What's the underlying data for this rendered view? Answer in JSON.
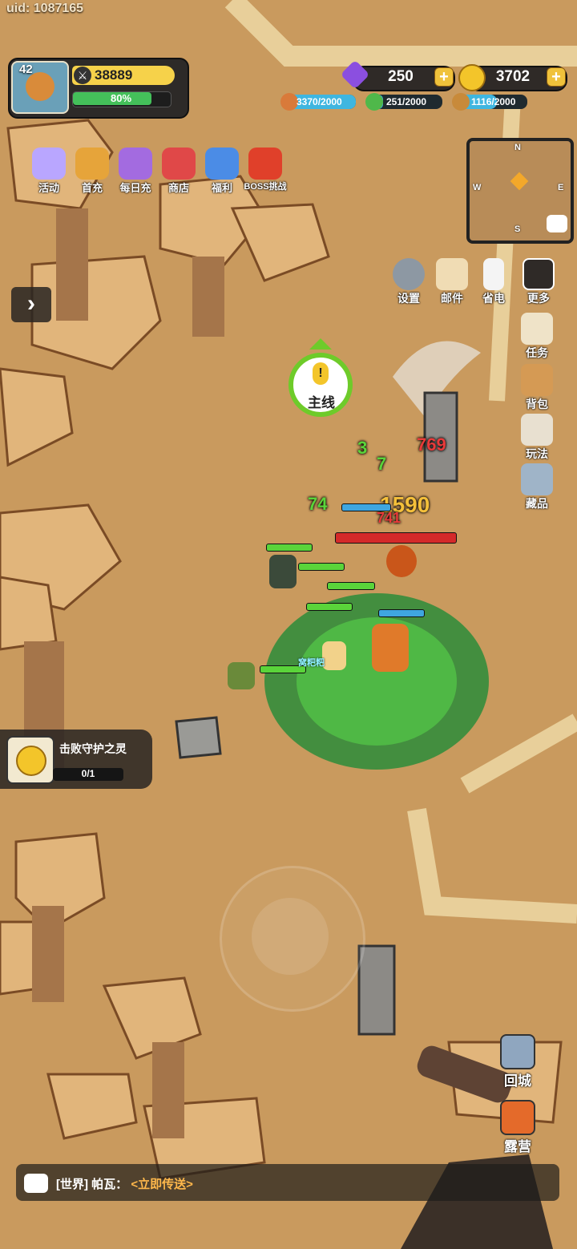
{
  "uid": "uid: 1087165",
  "player": {
    "level": "42",
    "power": "38889",
    "exp_text": "80%",
    "exp_progress": 0.8
  },
  "currencies": {
    "gems": "250",
    "gold": "3702"
  },
  "resources": [
    {
      "name": "meat",
      "value": "3370/2000",
      "color": "#3fb6e0"
    },
    {
      "name": "herb",
      "value": "251/2000",
      "color": "#3fb6e0"
    },
    {
      "name": "wood",
      "value": "1116/2000",
      "color": "#3fb6e0"
    }
  ],
  "top_menu": [
    {
      "label": "活动",
      "icon": "event-icon",
      "color": "#b9a6ff"
    },
    {
      "label": "首充",
      "icon": "first-recharge-icon",
      "color": "#e6a43a"
    },
    {
      "label": "每日充",
      "icon": "daily-recharge-icon",
      "color": "#a36be0"
    },
    {
      "label": "商店",
      "icon": "shop-icon",
      "color": "#e04848"
    },
    {
      "label": "福利",
      "icon": "gift-icon",
      "color": "#4b8ce6"
    },
    {
      "label": "BOSS挑战",
      "icon": "boss-challenge-icon",
      "color": "#e0402a"
    }
  ],
  "minimap": {
    "n": "N",
    "s": "S",
    "e": "E",
    "w": "W"
  },
  "right_icons_row": [
    {
      "label": "设置",
      "icon": "gear-icon"
    },
    {
      "label": "邮件",
      "icon": "mail-icon"
    },
    {
      "label": "省电",
      "icon": "battery-icon"
    },
    {
      "label": "更多",
      "icon": "more-icon"
    }
  ],
  "right_icons_col": [
    {
      "label": "任务",
      "icon": "scroll-icon"
    },
    {
      "label": "背包",
      "icon": "backpack-icon"
    },
    {
      "label": "玩法",
      "icon": "gameplay-icon"
    },
    {
      "label": "藏品",
      "icon": "collection-icon"
    }
  ],
  "quest": {
    "label": "主线",
    "mark": "!"
  },
  "damage_numbers": [
    {
      "text": "769",
      "color": "#e83a3a"
    },
    {
      "text": "3",
      "color": "#5ad43a"
    },
    {
      "text": "7",
      "color": "#5ad43a"
    },
    {
      "text": "74",
      "color": "#5ad43a"
    },
    {
      "text": "1590",
      "color": "#f5c03a"
    },
    {
      "text": "741",
      "color": "#e83a3a"
    }
  ],
  "hero_name": "窝粑粑",
  "task": {
    "title": "击败守护之灵",
    "progress": "0/1"
  },
  "bottom_right": [
    {
      "label": "回城",
      "icon": "return-city-icon"
    },
    {
      "label": "露营",
      "icon": "camp-icon"
    }
  ],
  "chat": {
    "channel": "[世界]",
    "sender": "帕瓦：",
    "link": "<立即传送>"
  }
}
